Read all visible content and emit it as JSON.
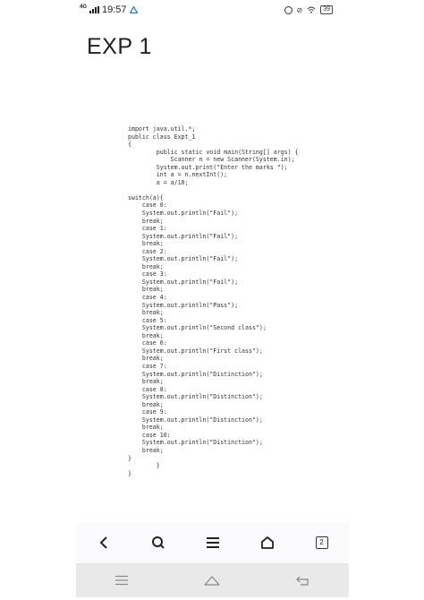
{
  "status_bar": {
    "network": "4G",
    "time": "19:57",
    "battery": "39"
  },
  "page": {
    "title": "EXP 1",
    "code_lines": [
      "import java.util.*;",
      "public class Expt_1",
      "{",
      "        public static void main(String[] args) {",
      "            Scanner n = new Scanner(System.in);",
      "        System.out.print(\"Enter the marks \");",
      "        int a = n.nextInt();",
      "        a = a/10;",
      "",
      "switch(a){",
      "    case 0:",
      "    System.out.println(\"Fail\");",
      "    break;",
      "    case 1:",
      "    System.out.println(\"Fail\");",
      "    break;",
      "    case 2:",
      "    System.out.println(\"Fail\");",
      "    break;",
      "    case 3:",
      "    System.out.println(\"Fail\");",
      "    break;",
      "    case 4:",
      "    System.out.println(\"Pass\");",
      "    break;",
      "    case 5:",
      "    System.out.println(\"Second class\");",
      "    break;",
      "    case 6:",
      "    System.out.println(\"First class\");",
      "    break;",
      "    case 7:",
      "    System.out.println(\"Distinction\");",
      "    break;",
      "    case 8:",
      "    System.out.println(\"Distinction\");",
      "    break;",
      "    case 9:",
      "    System.out.println(\"Distinction\");",
      "    break;",
      "    case 10:",
      "    System.out.println(\"Distinction\");",
      "    break;",
      "}",
      "        }",
      "}"
    ]
  },
  "toolbar": {
    "tab_count": "2",
    "icons": [
      "back-icon",
      "search-icon",
      "menu-icon",
      "home-icon",
      "tabs-icon"
    ]
  },
  "system_nav": {
    "icons": [
      "recents-menu-icon",
      "home-icon",
      "back-icon"
    ]
  },
  "colors": {
    "accent": "#1a73e8",
    "toolbar_bg": "#fbfafc",
    "nav_bg": "#e9e9e9"
  }
}
